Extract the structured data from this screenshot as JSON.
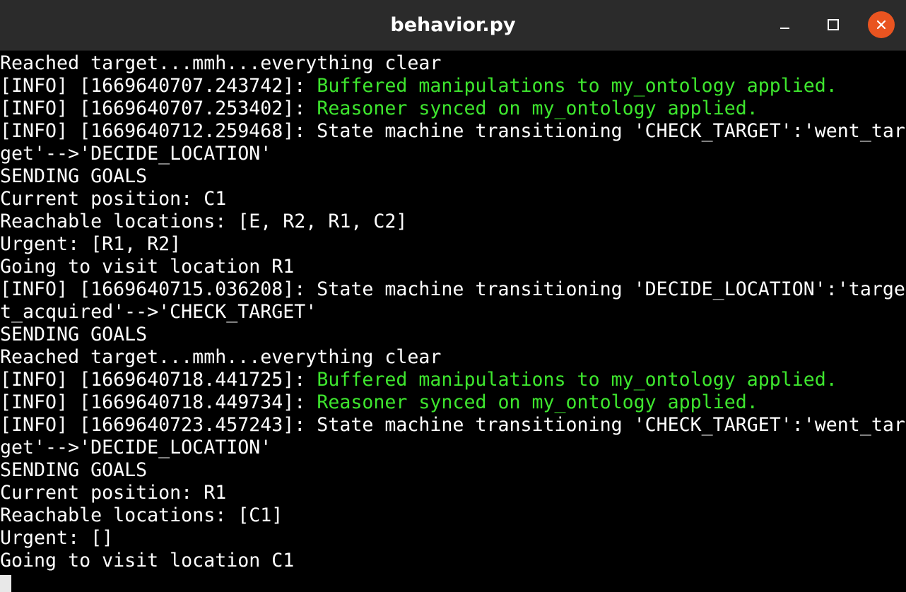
{
  "window": {
    "title": "behavior.py",
    "controls": {
      "minimize_icon": "minimize-icon",
      "maximize_icon": "maximize-icon",
      "close_icon": "close-icon",
      "close_color": "#e95420"
    }
  },
  "colors": {
    "background": "#000000",
    "text": "#ffffff",
    "highlight": "#3ee62e",
    "titlebar": "#2b2b2b"
  },
  "terminal": {
    "lines": [
      [
        {
          "text": "Reached target...mmh...everything clear",
          "color": "white"
        }
      ],
      [
        {
          "text": "[INFO] [1669640707.243742]: ",
          "color": "white"
        },
        {
          "text": "Buffered manipulations to my_ontology applied.",
          "color": "green"
        }
      ],
      [
        {
          "text": "[INFO] [1669640707.253402]: ",
          "color": "white"
        },
        {
          "text": "Reasoner synced on my_ontology applied.",
          "color": "green"
        }
      ],
      [
        {
          "text": "[INFO] [1669640712.259468]: State machine transitioning 'CHECK_TARGET':'went_tar",
          "color": "white"
        }
      ],
      [
        {
          "text": "get'-->'DECIDE_LOCATION'",
          "color": "white"
        }
      ],
      [
        {
          "text": "SENDING GOALS",
          "color": "white"
        }
      ],
      [
        {
          "text": "Current position: C1",
          "color": "white"
        }
      ],
      [
        {
          "text": "Reachable locations: [E, R2, R1, C2]",
          "color": "white"
        }
      ],
      [
        {
          "text": "Urgent: [R1, R2]",
          "color": "white"
        }
      ],
      [
        {
          "text": "Going to visit location R1",
          "color": "white"
        }
      ],
      [
        {
          "text": "[INFO] [1669640715.036208]: State machine transitioning 'DECIDE_LOCATION':'targe",
          "color": "white"
        }
      ],
      [
        {
          "text": "t_acquired'-->'CHECK_TARGET'",
          "color": "white"
        }
      ],
      [
        {
          "text": "SENDING GOALS",
          "color": "white"
        }
      ],
      [
        {
          "text": "Reached target...mmh...everything clear",
          "color": "white"
        }
      ],
      [
        {
          "text": "[INFO] [1669640718.441725]: ",
          "color": "white"
        },
        {
          "text": "Buffered manipulations to my_ontology applied.",
          "color": "green"
        }
      ],
      [
        {
          "text": "[INFO] [1669640718.449734]: ",
          "color": "white"
        },
        {
          "text": "Reasoner synced on my_ontology applied.",
          "color": "green"
        }
      ],
      [
        {
          "text": "[INFO] [1669640723.457243]: State machine transitioning 'CHECK_TARGET':'went_tar",
          "color": "white"
        }
      ],
      [
        {
          "text": "get'-->'DECIDE_LOCATION'",
          "color": "white"
        }
      ],
      [
        {
          "text": "SENDING GOALS",
          "color": "white"
        }
      ],
      [
        {
          "text": "Current position: R1",
          "color": "white"
        }
      ],
      [
        {
          "text": "Reachable locations: [C1]",
          "color": "white"
        }
      ],
      [
        {
          "text": "Urgent: []",
          "color": "white"
        }
      ],
      [
        {
          "text": "Going to visit location C1",
          "color": "white"
        }
      ]
    ],
    "cursor": "block-cursor"
  }
}
